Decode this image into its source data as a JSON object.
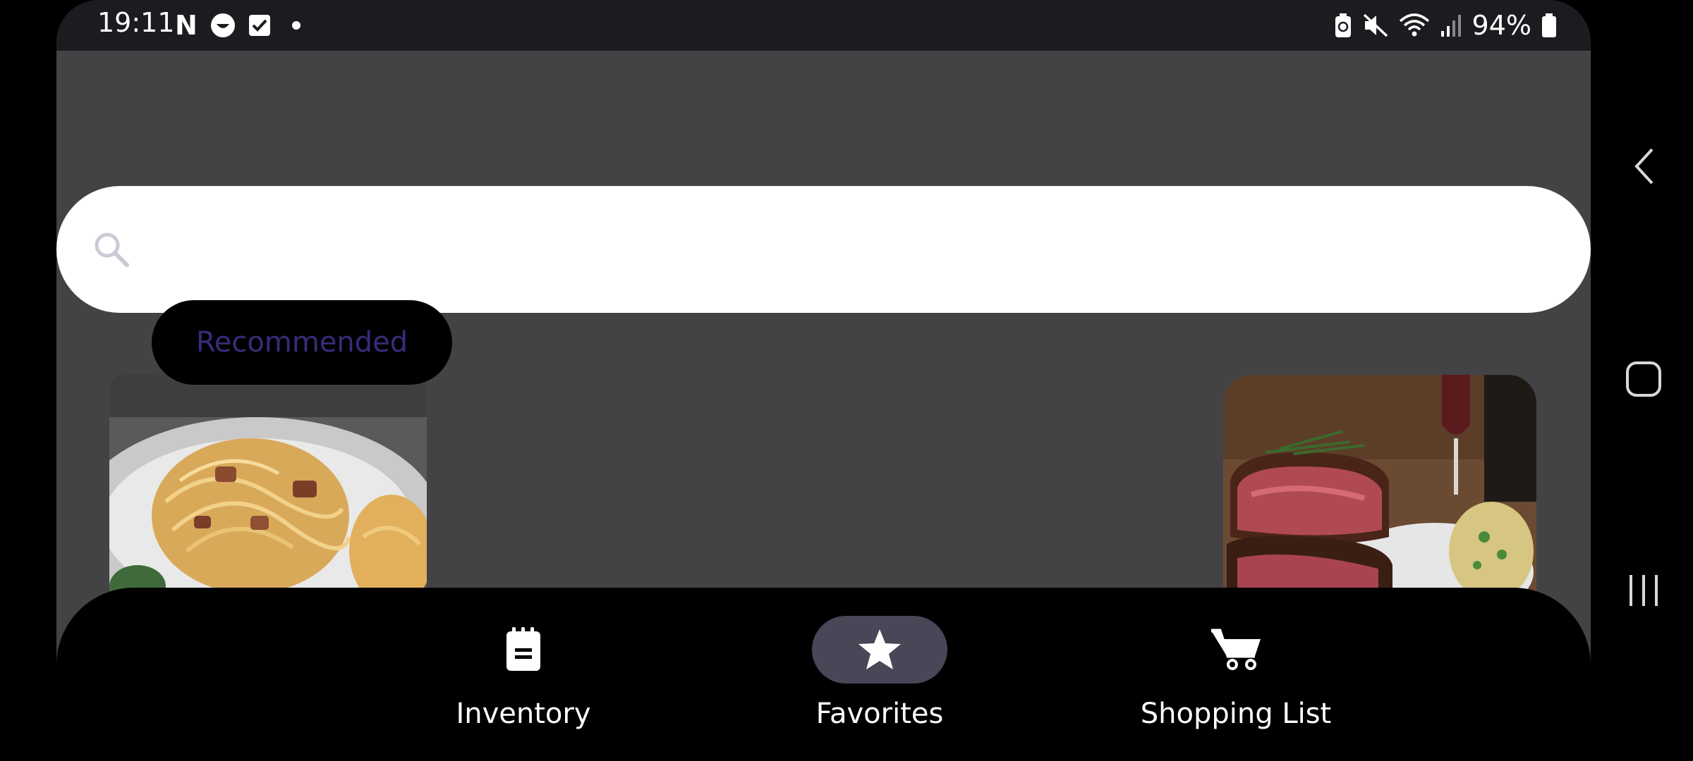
{
  "status_bar": {
    "time": "19:11",
    "left_icons": [
      "netflix-icon",
      "smile-icon",
      "checkbox-icon",
      "dot-icon"
    ],
    "netflix_glyph": "N",
    "right_icons": [
      "battery-saver-icon",
      "mute-icon",
      "wifi-icon",
      "signal-icon",
      "battery-icon"
    ],
    "battery_percent": "94%"
  },
  "search": {
    "placeholder": "",
    "value": ""
  },
  "filter_chip": {
    "label": "Recommended"
  },
  "recipes": [
    {
      "image_icon": "spaghetti-carbonara-image"
    },
    {
      "image_icon": "steak-dinner-image"
    }
  ],
  "bottom_nav": {
    "items": [
      {
        "label": "Inventory",
        "icon": "notepad-icon",
        "selected": false
      },
      {
        "label": "Favorites",
        "icon": "star-icon",
        "selected": true
      },
      {
        "label": "Shopping List",
        "icon": "cart-icon",
        "selected": false
      }
    ]
  },
  "system_nav": {
    "buttons": [
      "back-icon",
      "home-icon",
      "recents-icon"
    ]
  },
  "colors": {
    "background": "#434345",
    "status_bar": "#1c1c20",
    "search_bg": "#ffffff",
    "chip_bg": "#000000",
    "chip_text": "#3b2a7a",
    "nav_bg": "#000000",
    "nav_selected_pill": "#4a4557"
  }
}
